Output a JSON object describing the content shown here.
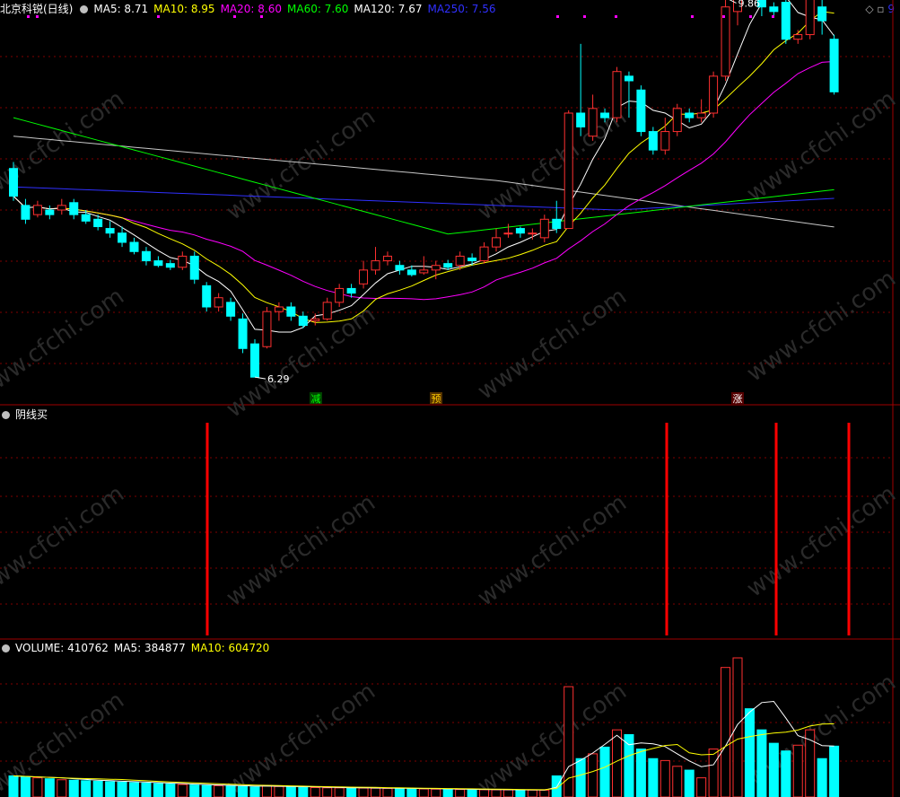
{
  "main_header": {
    "title": "北京科锐(日线)",
    "ma": [
      {
        "label": "MA5: 8.71",
        "color": "#ffffff"
      },
      {
        "label": "MA10: 8.95",
        "color": "#ffff00"
      },
      {
        "label": "MA20: 8.60",
        "color": "#ff00ff"
      },
      {
        "label": "MA60: 7.60",
        "color": "#00ff00"
      },
      {
        "label": "MA120: 7.67",
        "color": "#ffffff"
      },
      {
        "label": "MA250: 7.56",
        "color": "#3030ff"
      }
    ]
  },
  "indicator_header": {
    "title": "阴线买"
  },
  "volume_header": {
    "title": "VOLUME: 410762",
    "ma5": "MA5: 384877",
    "ma10": "MA10: 604720",
    "ma10_color": "#ffff00"
  },
  "right_marker": "9",
  "annotations": {
    "high": "9.86",
    "low": "6.29"
  },
  "signals": [
    {
      "text": "减",
      "color": "#00ff00",
      "bg": "#004400"
    },
    {
      "text": "预",
      "color": "#ffcc00",
      "bg": "#553300"
    },
    {
      "text": "涨",
      "color": "#ffffff",
      "bg": "#550000"
    }
  ],
  "colors": {
    "up": "#ff3030",
    "down": "#00ffff",
    "grid": "#800000",
    "bar": "#ff0000",
    "marker": "#ff00ff"
  },
  "chart_data": [
    {
      "type": "candlestick",
      "title": "北京科锐(日线)",
      "ylim": [
        6.0,
        10.1
      ],
      "candles": [
        [
          8.55,
          8.25,
          8.62,
          8.2
        ],
        [
          8.15,
          8.0,
          8.22,
          7.95
        ],
        [
          8.05,
          8.15,
          8.2,
          8.02
        ],
        [
          8.1,
          8.05,
          8.15,
          8.0
        ],
        [
          8.1,
          8.15,
          8.22,
          8.05
        ],
        [
          8.18,
          8.05,
          8.22,
          8.0
        ],
        [
          8.05,
          7.98,
          8.1,
          7.95
        ],
        [
          8.0,
          7.92,
          8.05,
          7.88
        ],
        [
          7.9,
          7.85,
          7.98,
          7.8
        ],
        [
          7.85,
          7.75,
          7.92,
          7.7
        ],
        [
          7.75,
          7.65,
          7.8,
          7.62
        ],
        [
          7.65,
          7.55,
          7.7,
          7.5
        ],
        [
          7.55,
          7.5,
          7.6,
          7.48
        ],
        [
          7.52,
          7.48,
          7.56,
          7.45
        ],
        [
          7.48,
          7.6,
          7.65,
          7.45
        ],
        [
          7.6,
          7.35,
          7.65,
          7.3
        ],
        [
          7.28,
          7.05,
          7.32,
          7.0
        ],
        [
          7.05,
          7.15,
          7.2,
          7.0
        ],
        [
          7.1,
          6.95,
          7.15,
          6.9
        ],
        [
          6.92,
          6.6,
          6.98,
          6.55
        ],
        [
          6.65,
          6.29,
          6.7,
          6.29
        ],
        [
          6.62,
          7.0,
          7.05,
          6.6
        ],
        [
          7.0,
          7.05,
          7.1,
          6.9
        ],
        [
          7.05,
          6.95,
          7.1,
          6.9
        ],
        [
          6.95,
          6.85,
          7.0,
          6.82
        ],
        [
          6.9,
          6.92,
          6.98,
          6.85
        ],
        [
          6.92,
          7.1,
          7.15,
          6.9
        ],
        [
          7.1,
          7.25,
          7.3,
          7.05
        ],
        [
          7.25,
          7.2,
          7.3,
          7.15
        ],
        [
          7.3,
          7.45,
          7.55,
          7.25
        ],
        [
          7.45,
          7.55,
          7.7,
          7.4
        ],
        [
          7.55,
          7.6,
          7.65,
          7.5
        ],
        [
          7.5,
          7.45,
          7.55,
          7.4
        ],
        [
          7.45,
          7.4,
          7.5,
          7.38
        ],
        [
          7.42,
          7.45,
          7.6,
          7.4
        ],
        [
          7.45,
          7.5,
          7.55,
          7.35
        ],
        [
          7.52,
          7.48,
          7.56,
          7.45
        ],
        [
          7.5,
          7.6,
          7.65,
          7.45
        ],
        [
          7.58,
          7.55,
          7.63,
          7.5
        ],
        [
          7.55,
          7.7,
          7.75,
          7.52
        ],
        [
          7.7,
          7.8,
          7.9,
          7.65
        ],
        [
          7.85,
          7.85,
          7.95,
          7.8
        ],
        [
          7.9,
          7.85,
          7.92,
          7.8
        ],
        [
          7.85,
          7.85,
          7.9,
          7.78
        ],
        [
          7.8,
          8.0,
          8.05,
          7.75
        ],
        [
          8.0,
          7.9,
          8.2,
          7.85
        ],
        [
          7.9,
          9.15,
          9.18,
          7.9
        ],
        [
          9.15,
          9.0,
          9.9,
          8.9
        ],
        [
          8.9,
          9.2,
          9.35,
          8.85
        ],
        [
          9.15,
          9.1,
          9.2,
          9.05
        ],
        [
          9.1,
          9.6,
          9.65,
          9.05
        ],
        [
          9.55,
          9.5,
          9.6,
          9.1
        ],
        [
          9.4,
          8.95,
          9.45,
          8.9
        ],
        [
          8.95,
          8.75,
          9.0,
          8.7
        ],
        [
          8.75,
          8.95,
          9.1,
          8.7
        ],
        [
          8.95,
          9.2,
          9.25,
          8.9
        ],
        [
          9.15,
          9.1,
          9.2,
          9.05
        ],
        [
          9.1,
          9.15,
          9.3,
          9.05
        ],
        [
          9.15,
          9.55,
          9.6,
          9.1
        ],
        [
          9.55,
          10.3,
          10.4,
          9.5
        ],
        [
          10.25,
          10.85,
          10.9,
          10.1
        ],
        [
          10.8,
          10.7,
          10.85,
          10.5
        ],
        [
          10.6,
          10.3,
          10.65,
          10.2
        ],
        [
          10.3,
          10.25,
          10.35,
          10.2
        ],
        [
          10.35,
          9.95,
          10.4,
          9.9
        ],
        [
          9.95,
          10.0,
          10.05,
          9.9
        ],
        [
          10.0,
          10.45,
          10.5,
          9.95
        ],
        [
          10.3,
          10.15,
          10.4,
          10.0
        ],
        [
          9.95,
          9.38,
          10.0,
          9.35
        ]
      ]
    },
    {
      "type": "bar",
      "title": "阴线买",
      "signal_indices": [
        16,
        52,
        61,
        67
      ]
    },
    {
      "type": "bar",
      "title": "VOLUME",
      "values": [
        22000,
        21000,
        20000,
        19000,
        18000,
        17500,
        17000,
        16500,
        16000,
        15500,
        15000,
        14500,
        14000,
        13500,
        13000,
        12500,
        12000,
        11800,
        11500,
        11000,
        10500,
        12000,
        11000,
        10500,
        10000,
        9800,
        9600,
        9500,
        9400,
        9300,
        9200,
        9000,
        8800,
        8600,
        8400,
        8200,
        8000,
        7800,
        7700,
        7600,
        7500,
        7400,
        7300,
        7200,
        7100,
        22000,
        115000,
        40000,
        45000,
        52000,
        70000,
        65000,
        50000,
        40000,
        38000,
        32000,
        28000,
        20000,
        50000,
        135000,
        145000,
        92000,
        70000,
        56000,
        48000,
        54000,
        70000,
        40000,
        53000
      ]
    }
  ]
}
